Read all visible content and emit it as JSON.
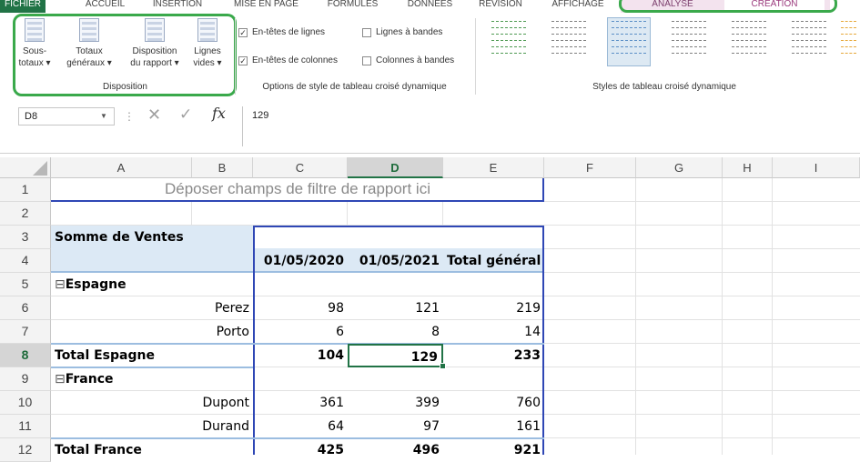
{
  "ribbon": {
    "tabs": [
      "FICHIER",
      "ACCUEIL",
      "INSERTION",
      "MISE EN PAGE",
      "FORMULES",
      "DONNÉES",
      "RÉVISION",
      "AFFICHAGE",
      "ANALYSE",
      "CRÉATION"
    ],
    "disposition": {
      "group_label": "Disposition",
      "buttons": [
        {
          "l1": "Sous-",
          "l2": "totaux ▾"
        },
        {
          "l1": "Totaux",
          "l2": "généraux ▾"
        },
        {
          "l1": "Disposition",
          "l2": "du rapport ▾"
        },
        {
          "l1": "Lignes",
          "l2": "vides ▾"
        }
      ]
    },
    "options": {
      "group_label": "Options de style de tableau croisé dynamique",
      "row_headers": "En-têtes de lignes",
      "col_headers": "En-têtes de colonnes",
      "banded_rows": "Lignes à bandes",
      "banded_cols": "Colonnes à bandes",
      "row_headers_checked": true,
      "col_headers_checked": true,
      "banded_rows_checked": false,
      "banded_cols_checked": false
    },
    "styles": {
      "group_label": "Styles de tableau croisé dynamique",
      "thumb_colors": [
        "#4e9a52",
        "#7f7f7f",
        "#5b8fc7",
        "#7f7f7f",
        "#7f7f7f",
        "#7f7f7f",
        "#e6a83a"
      ]
    }
  },
  "formula_bar": {
    "name_box": "D8",
    "cancel_icon": "✕",
    "enter_icon": "✓",
    "fx_label": "fx",
    "content": "129"
  },
  "sheet": {
    "columns": [
      "A",
      "B",
      "C",
      "D",
      "E",
      "F",
      "G",
      "H",
      "I"
    ],
    "selected_column": "D",
    "rows": [
      "1",
      "2",
      "3",
      "4",
      "5",
      "6",
      "7",
      "8",
      "9",
      "10",
      "11",
      "12"
    ],
    "selected_row": "8",
    "pivot": {
      "filter_placeholder": "Déposer champs de filtre de rapport ici",
      "value_header": "Somme de Ventes",
      "col_dates": [
        "01/05/2020",
        "01/05/2021"
      ],
      "grand_total_header": "Total général",
      "groups": [
        {
          "name": "Espagne",
          "items": [
            {
              "name": "Perez",
              "v2020": "98",
              "v2021": "121",
              "total": "219"
            },
            {
              "name": "Porto",
              "v2020": "6",
              "v2021": "8",
              "total": "14"
            }
          ],
          "total_label": "Total Espagne",
          "total": {
            "v2020": "104",
            "v2021": "129",
            "total": "233"
          }
        },
        {
          "name": "France",
          "items": [
            {
              "name": "Dupont",
              "v2020": "361",
              "v2021": "399",
              "total": "760"
            },
            {
              "name": "Durand",
              "v2020": "64",
              "v2021": "97",
              "total": "161"
            }
          ],
          "total_label": "Total France",
          "total": {
            "v2020": "425",
            "v2021": "496",
            "total": "921"
          }
        }
      ],
      "collapse_symbol": "⊟"
    }
  },
  "colors": {
    "excel_green": "#217346",
    "highlight_green": "#3aa94b",
    "pivot_border": "#2f47b5",
    "band_blue": "#dce9f5"
  }
}
